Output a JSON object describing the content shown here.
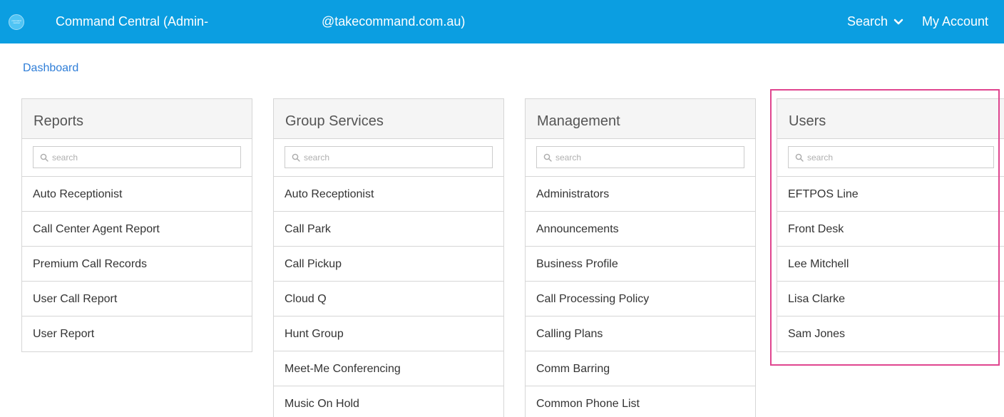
{
  "header": {
    "logo_text": "command central",
    "title": "Command Central (Admin-",
    "email": "@takecommand.com.au)",
    "search_label": "Search",
    "account_label": "My Account"
  },
  "breadcrumb": "Dashboard",
  "panels": {
    "reports": {
      "title": "Reports",
      "search_placeholder": "search",
      "items": [
        "Auto Receptionist",
        "Call Center Agent Report",
        "Premium Call Records",
        "User Call Report",
        "User Report"
      ]
    },
    "group_services": {
      "title": "Group Services",
      "search_placeholder": "search",
      "items": [
        "Auto Receptionist",
        "Call Park",
        "Call Pickup",
        "Cloud Q",
        "Hunt Group",
        "Meet-Me Conferencing",
        "Music On Hold"
      ]
    },
    "management": {
      "title": "Management",
      "search_placeholder": "search",
      "items": [
        "Administrators",
        "Announcements",
        "Business Profile",
        "Call Processing Policy",
        "Calling Plans",
        "Comm Barring",
        "Common Phone List"
      ]
    },
    "users": {
      "title": "Users",
      "search_placeholder": "search",
      "items": [
        "EFTPOS Line",
        "Front Desk",
        "Lee Mitchell",
        "Lisa Clarke",
        "Sam Jones"
      ]
    }
  },
  "colors": {
    "header_bg": "#0b9ee1",
    "link": "#2f7ed8",
    "highlight": "#e0458f"
  },
  "icons": {
    "logo": "command-central-logo",
    "search_menu": "chevron-down-icon",
    "panel_search": "magnifier-icon"
  }
}
